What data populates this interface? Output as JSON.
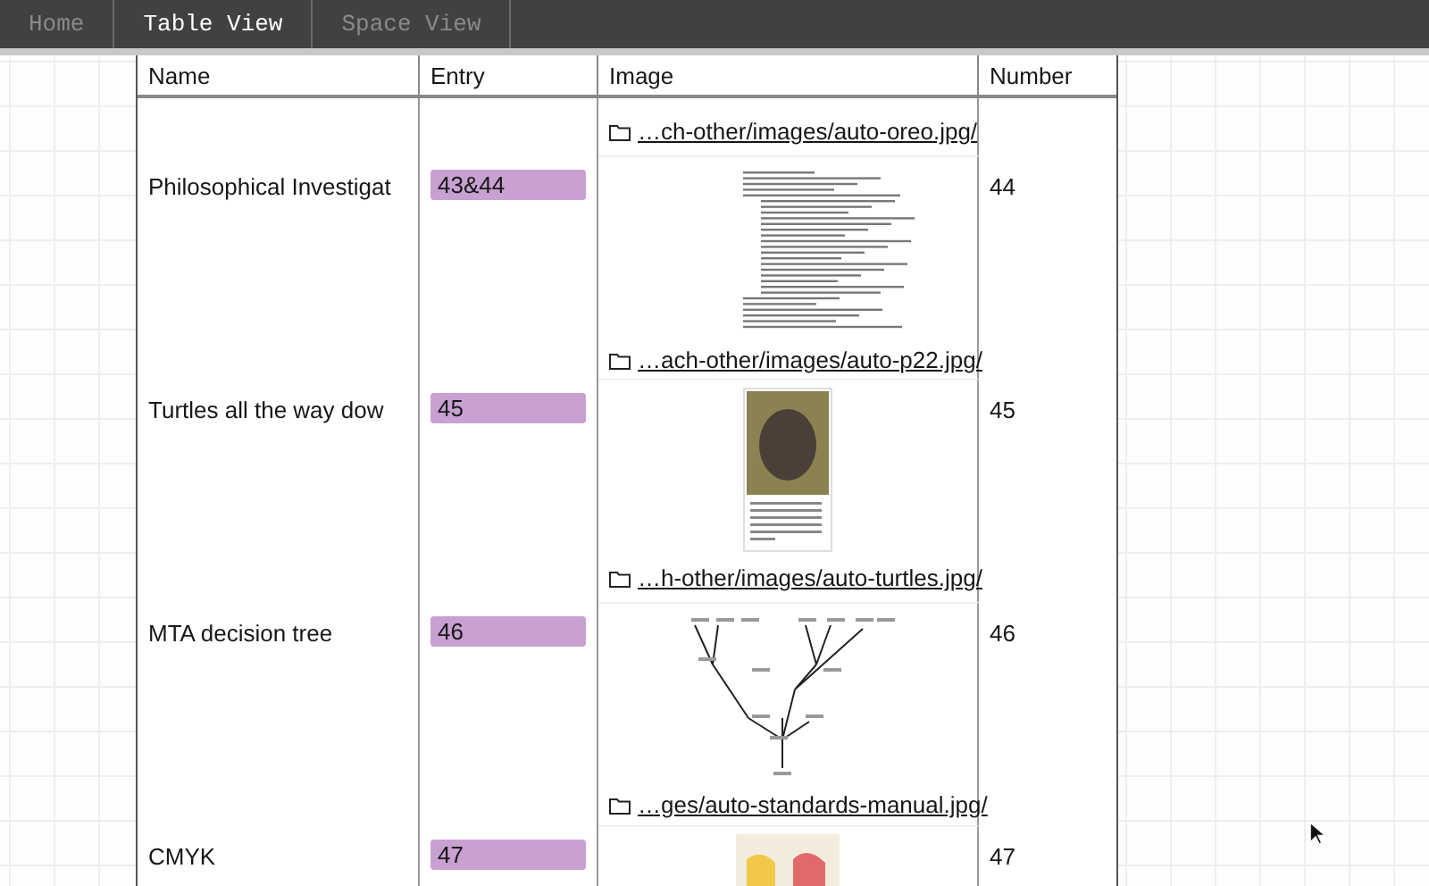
{
  "tabs": [
    {
      "label": "Home",
      "selected": false
    },
    {
      "label": "Table View",
      "selected": true
    },
    {
      "label": "Space View",
      "selected": false
    }
  ],
  "table": {
    "columns": [
      "Name",
      "Entry",
      "Image",
      "Number"
    ],
    "rows": [
      {
        "image_link": "…ch-other/images/auto-oreo.jpg/"
      },
      {
        "name": "Philosophical Investigat",
        "entry": "43&44",
        "image": {
          "kind": "page"
        },
        "image_link": "…ach-other/images/auto-p22.jpg/",
        "number": "44"
      },
      {
        "name": "Turtles all the way dow",
        "entry": "45",
        "image": {
          "kind": "photo"
        },
        "image_link": "…h-other/images/auto-turtles.jpg/",
        "number": "45"
      },
      {
        "name": "MTA decision tree",
        "entry": "46",
        "image": {
          "kind": "tree"
        },
        "image_link": "…ges/auto-standards-manual.jpg/",
        "number": "46"
      },
      {
        "name": "CMYK",
        "entry": "47",
        "image": {
          "kind": "print"
        },
        "number": "47"
      }
    ]
  }
}
